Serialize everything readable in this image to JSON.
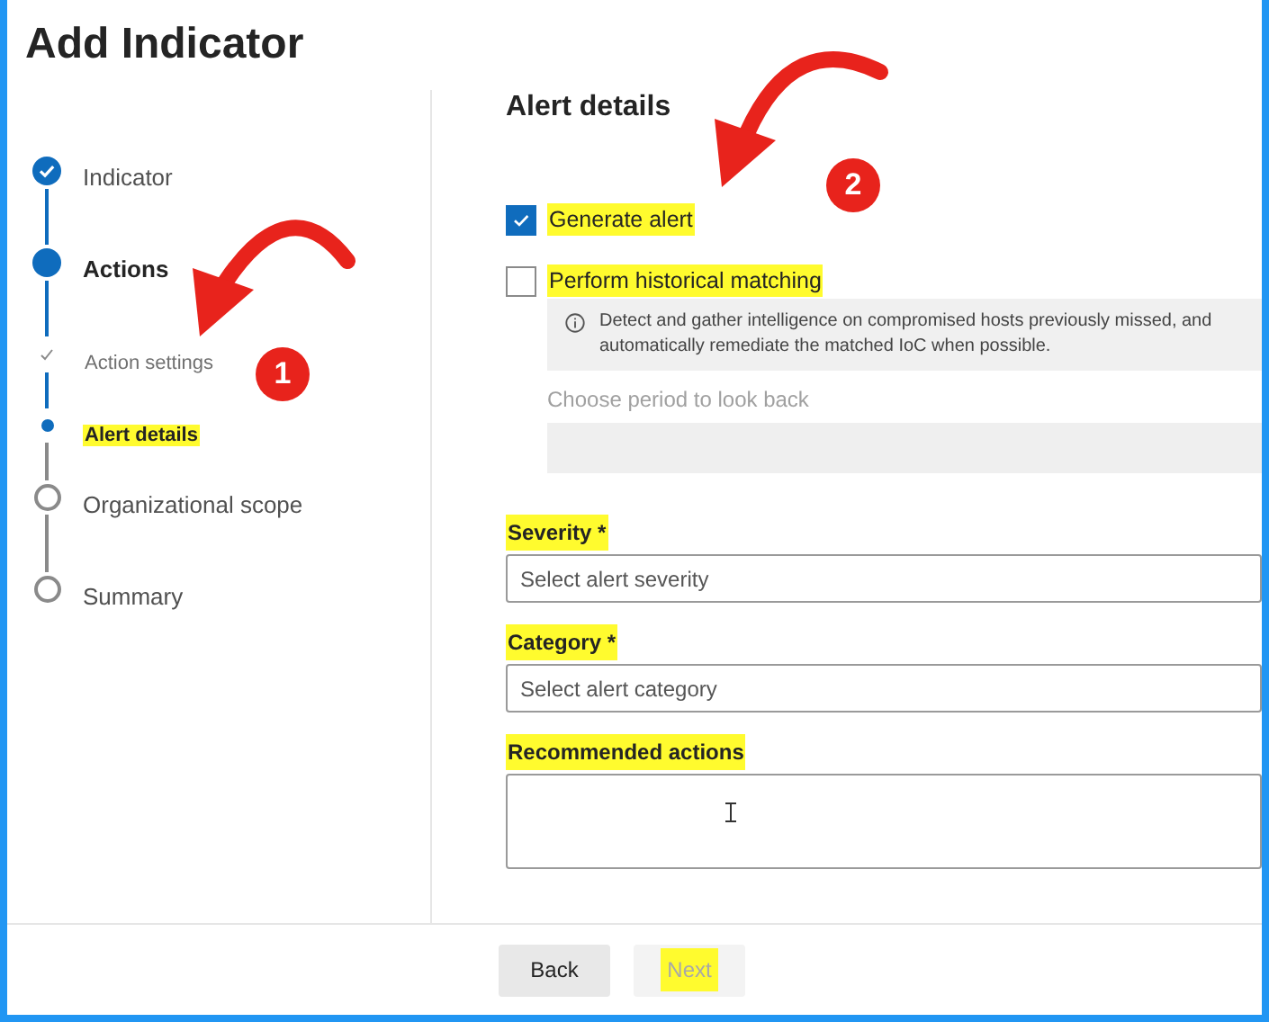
{
  "title": "Add Indicator",
  "steps": [
    {
      "label": "Indicator",
      "completed": true,
      "current": false
    },
    {
      "label": "Actions",
      "completed": false,
      "current": true,
      "children": [
        {
          "label": "Action settings",
          "completed": true,
          "current": false
        },
        {
          "label": "Alert details",
          "completed": false,
          "current": true,
          "highlighted": true
        }
      ]
    },
    {
      "label": "Organizational scope",
      "completed": false,
      "current": false
    },
    {
      "label": "Summary",
      "completed": false,
      "current": false
    }
  ],
  "section_title": "Alert details",
  "checkboxes": [
    {
      "label": "Generate alert",
      "checked": true,
      "highlighted": true
    },
    {
      "label": "Perform historical matching",
      "checked": false,
      "highlighted": true
    }
  ],
  "info_text": "Detect and gather intelligence on compromised hosts previously missed, and automatically remediate the matched IoC when possible.",
  "period": {
    "label": "Choose period to look back",
    "disabled": true
  },
  "fields": [
    {
      "kind": "select",
      "label": "Severity",
      "required_mark": "*",
      "placeholder": "Select alert severity",
      "highlighted": true
    },
    {
      "kind": "select",
      "label": "Category",
      "required_mark": "*",
      "placeholder": "Select alert category",
      "highlighted": true
    },
    {
      "kind": "textarea",
      "label": "Recommended actions",
      "highlighted": true
    }
  ],
  "buttons": [
    {
      "label": "Back",
      "disabled": false,
      "highlighted": false
    },
    {
      "label": "Next",
      "disabled": true,
      "highlighted": true
    }
  ],
  "callouts": [
    "1",
    "2"
  ]
}
